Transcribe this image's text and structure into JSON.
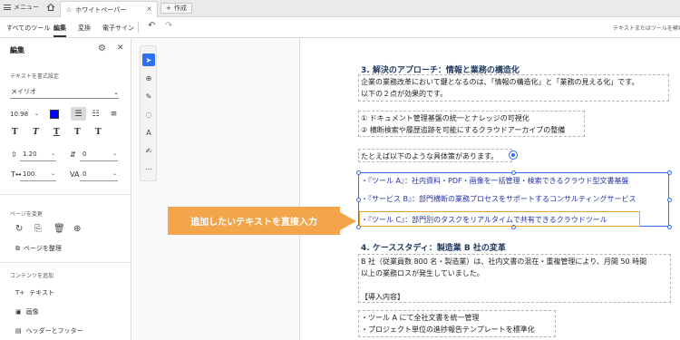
{
  "tabs": {
    "menu_label": "メニュー",
    "doc_label": "ホワイトペーパー",
    "new_label": "作成"
  },
  "toolbar": {
    "items": [
      "すべてのツール",
      "編集",
      "変換",
      "電子サイン"
    ],
    "search_label": "テキストまたはツールを検索"
  },
  "panel": {
    "title": "編集",
    "format_label": "テキストを書式設定",
    "font": "メイリオ",
    "font_size": "10.98",
    "color": "#0000ff",
    "line_spacing": "1.20",
    "para_spacing": "0",
    "horiz_scale": "100",
    "char_spacing": "0",
    "page_section": "ページを変更",
    "organize_label": "ページを整理",
    "content_section": "コンテンツを追加",
    "add_text": "テキスト",
    "add_image": "画像",
    "add_header": "ヘッダーとフッター"
  },
  "document": {
    "heading3": "3. 解決のアプローチ：情報と業務の構造化",
    "para3_line1": "企業の業務改革において鍵となるのは、「情報の構造化」と「業務の見える化」です。",
    "para3_line2": "以下の２点が効果的です。",
    "point1": "① ドキュメント管理基盤の統一とナレッジの可視化",
    "point2": "② 横断検索や履歴追跡を可能にするクラウドアーカイブの整備",
    "example_intro": "たとえば以下のような具体策があります。",
    "bullet1": "・『ツール A』：社内資料・PDF・画像を一括管理・検索できるクラウド型文書基盤",
    "bullet2": "・『サービス B』：部門横断の業務プロセスをサポートするコンサルティングサービス",
    "bullet3": "・『ツール C』：部門別のタスクをリアルタイムで共有できるクラウドツール",
    "heading4": "4. ケーススタディ：製造業 B 社の変革",
    "para4_line1": "B 社（従業員数 800 名・製造業）は、社内文書の混在・重複管理により、月間 50 時間",
    "para4_line2": "以上の業務ロスが発生していました。",
    "intro_label": "【導入内容】",
    "case1": "・ツール A にて全社文書を統一管理",
    "case2": "・プロジェクト単位の進捗報告テンプレートを標準化"
  },
  "callout": {
    "text": "追加したいテキストを直接入力"
  }
}
